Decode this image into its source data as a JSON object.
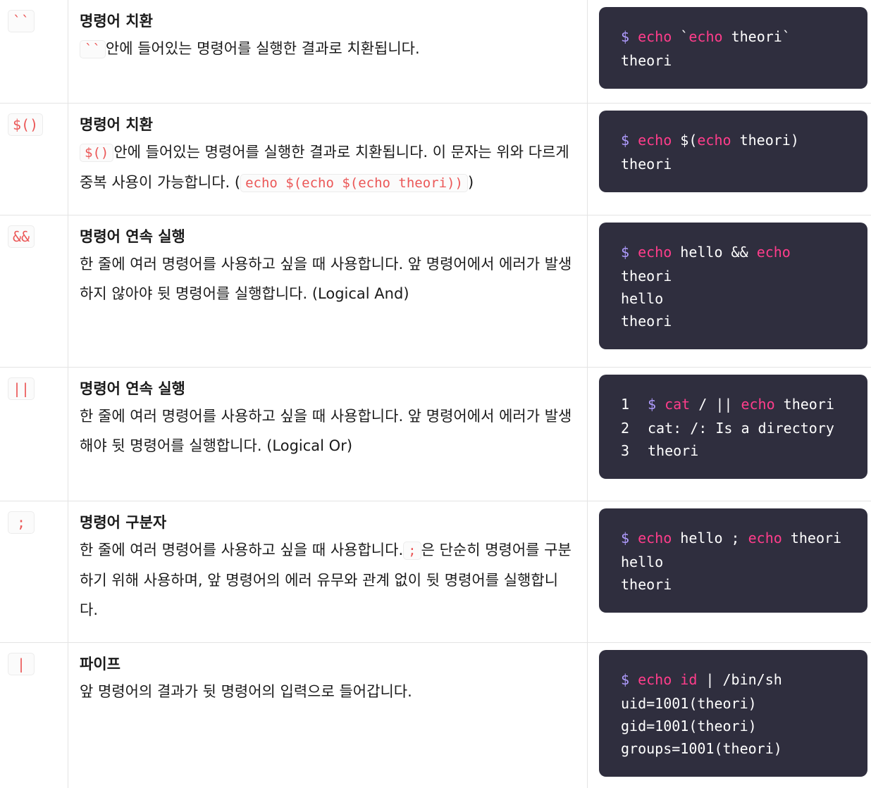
{
  "rows": [
    {
      "symbol": "``",
      "title": "명령어 치환",
      "body": [
        {
          "code": "``"
        },
        {
          "text": "안에 들어있는 명령어를 실행한 결과로 치환됩니다."
        }
      ],
      "code_lines": [
        [
          {
            "t": "$ ",
            "c": "d"
          },
          {
            "t": "echo",
            "c": "k"
          },
          {
            "t": " `"
          },
          {
            "t": "echo",
            "c": "k"
          },
          {
            "t": " theori`"
          }
        ],
        [
          {
            "t": "theori"
          }
        ]
      ]
    },
    {
      "symbol": "$()",
      "title": "명령어 치환",
      "body": [
        {
          "code": "$()"
        },
        {
          "text": "안에 들어있는 명령어를 실행한 결과로 치환됩니다. 이 문자는 위와 다르게 중복 사용이 가능합니다. ("
        },
        {
          "code": "echo $(echo $(echo theori))"
        },
        {
          "text": ")"
        }
      ],
      "code_lines": [
        [
          {
            "t": "$ ",
            "c": "d"
          },
          {
            "t": "echo",
            "c": "k"
          },
          {
            "t": " $("
          },
          {
            "t": "echo",
            "c": "k"
          },
          {
            "t": " theori)"
          }
        ],
        [
          {
            "t": "theori"
          }
        ]
      ]
    },
    {
      "symbol": "&&",
      "title": "명령어 연속 실행",
      "body": [
        {
          "text": "한 줄에 여러 명령어를 사용하고 싶을 때 사용합니다. 앞 명령어에서 에러가 발생하지 않아야 뒷 명령어를 실행합니다. (Logical And)"
        }
      ],
      "code_lines": [
        [
          {
            "t": "$ ",
            "c": "d"
          },
          {
            "t": "echo",
            "c": "k"
          },
          {
            "t": " hello && "
          },
          {
            "t": "echo",
            "c": "k"
          }
        ],
        [
          {
            "t": "theori"
          }
        ],
        [
          {
            "t": "hello"
          }
        ],
        [
          {
            "t": "theori"
          }
        ]
      ]
    },
    {
      "symbol": "||",
      "title": "명령어 연속 실행",
      "body": [
        {
          "text": "한 줄에 여러 명령어를 사용하고 싶을 때 사용합니다. 앞 명령어에서 에러가 발생해야 뒷 명령어를 실행합니다. (Logical Or)"
        }
      ],
      "numbered": true,
      "code_lines": [
        [
          {
            "t": "$ ",
            "c": "d"
          },
          {
            "t": "cat",
            "c": "k"
          },
          {
            "t": " / || "
          },
          {
            "t": "echo",
            "c": "k"
          },
          {
            "t": " theori"
          }
        ],
        [
          {
            "t": "cat: /: Is a directory"
          }
        ],
        [
          {
            "t": "theori"
          }
        ]
      ]
    },
    {
      "symbol": ";",
      "title": "명령어 구분자",
      "body": [
        {
          "text": "한 줄에 여러 명령어를 사용하고 싶을 때 사용합니다."
        },
        {
          "code": ";"
        },
        {
          "text": "은 단순히 명령어를 구분하기 위해 사용하며, 앞 명령어의 에러 유무와 관계 없이 뒷 명령어를 실행합니다."
        }
      ],
      "code_lines": [
        [
          {
            "t": "$ ",
            "c": "d"
          },
          {
            "t": "echo",
            "c": "k"
          },
          {
            "t": " hello ; "
          },
          {
            "t": "echo",
            "c": "k"
          },
          {
            "t": " theori"
          }
        ],
        [
          {
            "t": "hello"
          }
        ],
        [
          {
            "t": "theori"
          }
        ]
      ]
    },
    {
      "symbol": "|",
      "title": "파이프",
      "body": [
        {
          "text": "앞 명령어의 결과가 뒷 명령어의 입력으로 들어갑니다."
        }
      ],
      "code_lines": [
        [
          {
            "t": "$ ",
            "c": "d"
          },
          {
            "t": "echo id",
            "c": "k"
          },
          {
            "t": " | /bin/sh"
          }
        ],
        [
          {
            "t": "uid=1001(theori)"
          }
        ],
        [
          {
            "t": "gid=1001(theori)"
          }
        ],
        [
          {
            "t": "groups=1001(theori)"
          }
        ]
      ]
    }
  ]
}
